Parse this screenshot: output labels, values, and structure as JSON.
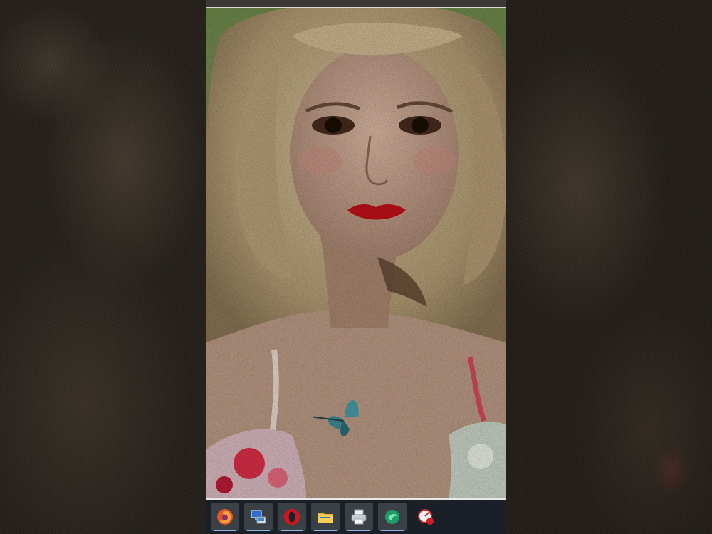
{
  "window": {
    "title": ""
  },
  "photo": {
    "subject": "portrait"
  },
  "taskbar": {
    "items": [
      {
        "icon": "firefox-icon",
        "active": true
      },
      {
        "icon": "network-computer-icon",
        "active": true
      },
      {
        "icon": "opera-icon",
        "active": true
      },
      {
        "icon": "file-explorer-icon",
        "active": true
      },
      {
        "icon": "printer-icon",
        "active": true
      },
      {
        "icon": "green-app-icon",
        "active": true
      },
      {
        "icon": "red-gauge-app-icon",
        "active": false
      }
    ]
  },
  "colors": {
    "taskbar_bg": "#1b2028",
    "accent_underline": "#8fb6e8"
  }
}
